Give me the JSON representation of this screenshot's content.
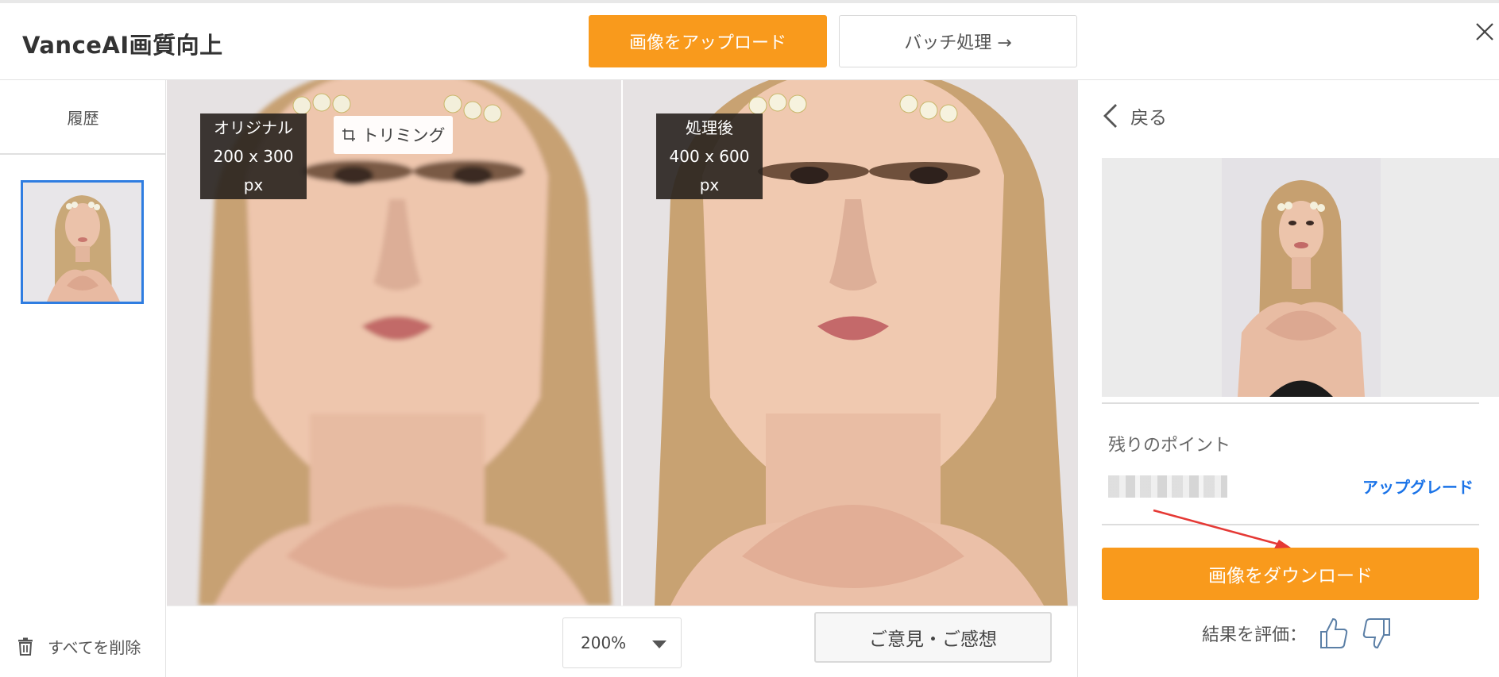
{
  "header": {
    "app_title": "VanceAI画質向上",
    "upload_label": "画像をアップロード",
    "batch_label": "バッチ処理 →"
  },
  "sidebar": {
    "history_label": "履歴",
    "delete_all_label": "すべてを削除"
  },
  "compare": {
    "original_label": "オリジナル",
    "original_size": "200 x 300 px",
    "trim_label": "トリミング",
    "processed_label": "処理後",
    "processed_size": "400 x 600 px"
  },
  "bottom": {
    "zoom_value": "200%",
    "feedback_label": "ご意見・ご感想"
  },
  "right_panel": {
    "back_label": "戻る",
    "points_label": "残りのポイント",
    "upgrade_label": "アップグレード",
    "download_label": "画像をダウンロード",
    "rate_label": "結果を評価："
  },
  "colors": {
    "accent_orange": "#f99a1c",
    "link_blue": "#1a73e8",
    "thumb_border_blue": "#2f7de1",
    "annotation_red": "#e53935"
  },
  "icons": [
    "close-icon",
    "trash-icon",
    "crop-icon",
    "chevron-left-icon",
    "chevron-down-icon",
    "thumbs-up-icon",
    "thumbs-down-icon"
  ]
}
